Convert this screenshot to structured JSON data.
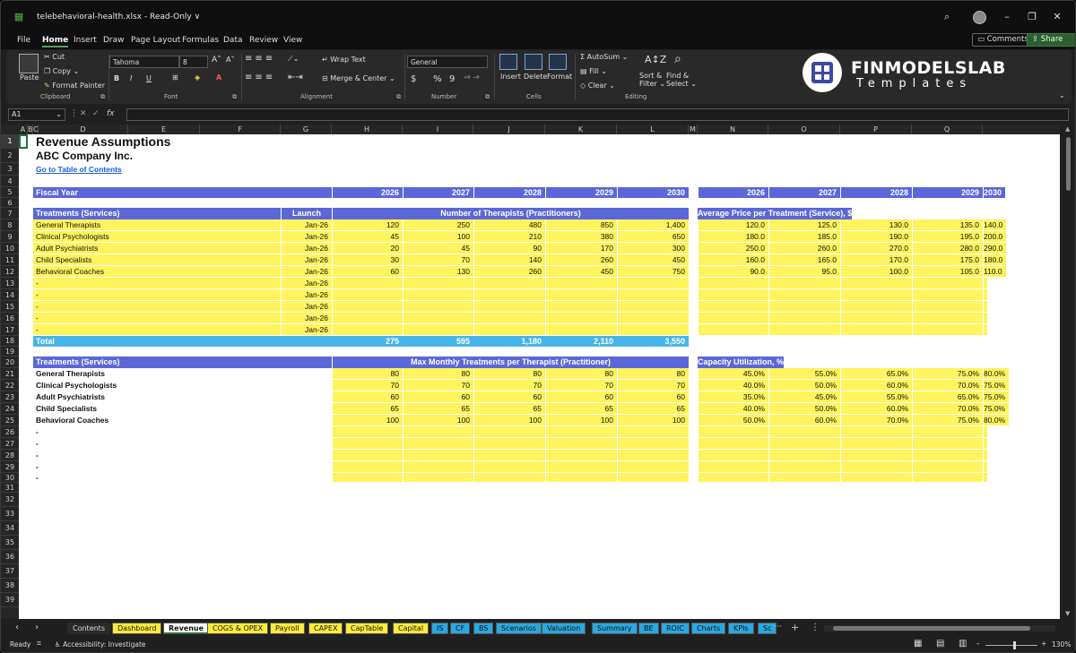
{
  "window": {
    "title": "telebehavioral-health.xlsx  -  Read-Only",
    "chevron": "∨"
  },
  "menu": [
    "File",
    "Home",
    "Insert",
    "Draw",
    "Page Layout",
    "Formulas",
    "Data",
    "Review",
    "View"
  ],
  "menu_right": {
    "comments": "Comments",
    "share": "Share"
  },
  "ribbon": {
    "clipboard": {
      "paste": "Paste",
      "cut": "Cut",
      "copy": "Copy",
      "format_painter": "Format Painter",
      "label": "Clipboard"
    },
    "font": {
      "name": "Tahoma",
      "size": "8",
      "bold": "B",
      "italic": "I",
      "underline": "U",
      "label": "Font"
    },
    "alignment": {
      "wrap": "Wrap Text",
      "merge": "Merge & Center",
      "label": "Alignment"
    },
    "number": {
      "format": "General",
      "currency": "$",
      "percent": "%",
      "comma": "9",
      "label": "Number"
    },
    "cells": {
      "insert": "Insert",
      "delete": "Delete",
      "format": "Format",
      "label": "Cells"
    },
    "editing": {
      "autosum": "AutoSum",
      "fill": "Fill",
      "clear": "Clear",
      "sort1": "Sort &",
      "sort2": "Filter",
      "find1": "Find &",
      "find2": "Select",
      "label": "Editing"
    },
    "logo": {
      "line1": "FINMODELSLAB",
      "line2": "Templates"
    }
  },
  "formula_bar": {
    "name_box": "A1",
    "fx": "fx"
  },
  "columns": [
    "A",
    "B",
    "C",
    "D",
    "E",
    "F",
    "G",
    "H",
    "I",
    "J",
    "K",
    "L",
    "M",
    "N",
    "O",
    "P",
    "Q"
  ],
  "rows": [
    "1",
    "2",
    "3",
    "4",
    "5",
    "6",
    "7",
    "8",
    "9",
    "10",
    "11",
    "12",
    "13",
    "14",
    "15",
    "16",
    "17",
    "18",
    "19",
    "20",
    "21",
    "22",
    "23",
    "24",
    "25",
    "26",
    "27",
    "28",
    "29",
    "30",
    "31",
    "32",
    "33",
    "34",
    "35",
    "36",
    "37",
    "38",
    "39"
  ],
  "sheet": {
    "title": "Revenue Assumptions",
    "company": "ABC Company Inc.",
    "toc_link": "Go to Table of Contents",
    "fiscal_year_label": "Fiscal Year",
    "years": [
      "2026",
      "2027",
      "2028",
      "2029",
      "2030"
    ],
    "t1_header": "Treatments (Services)",
    "launch_header": "Launch",
    "therapists_header": "Number of Therapists (Practitioners)",
    "price_header": "Average Price per Treatment (Service), $",
    "t1_rows": [
      {
        "name": "General Therapists",
        "launch": "Jan-26",
        "therapists": [
          "120",
          "250",
          "480",
          "850",
          "1,400"
        ],
        "price": [
          "120.0",
          "125.0",
          "130.0",
          "135.0",
          "140.0"
        ]
      },
      {
        "name": "Clinical Psychologists",
        "launch": "Jan-26",
        "therapists": [
          "45",
          "100",
          "210",
          "380",
          "650"
        ],
        "price": [
          "180.0",
          "185.0",
          "190.0",
          "195.0",
          "200.0"
        ]
      },
      {
        "name": "Adult Psychiatrists",
        "launch": "Jan-26",
        "therapists": [
          "20",
          "45",
          "90",
          "170",
          "300"
        ],
        "price": [
          "250.0",
          "260.0",
          "270.0",
          "280.0",
          "290.0"
        ]
      },
      {
        "name": "Child Specialists",
        "launch": "Jan-26",
        "therapists": [
          "30",
          "70",
          "140",
          "260",
          "450"
        ],
        "price": [
          "160.0",
          "165.0",
          "170.0",
          "175.0",
          "180.0"
        ]
      },
      {
        "name": "Behavioral Coaches",
        "launch": "Jan-26",
        "therapists": [
          "60",
          "130",
          "260",
          "450",
          "750"
        ],
        "price": [
          "90.0",
          "95.0",
          "100.0",
          "105.0",
          "110.0"
        ]
      },
      {
        "name": "-",
        "launch": "Jan-26",
        "therapists": [
          "",
          "",
          "",
          "",
          ""
        ],
        "price": [
          "",
          "",
          "",
          "",
          ""
        ]
      },
      {
        "name": "-",
        "launch": "Jan-26",
        "therapists": [
          "",
          "",
          "",
          "",
          ""
        ],
        "price": [
          "",
          "",
          "",
          "",
          ""
        ]
      },
      {
        "name": "-",
        "launch": "Jan-26",
        "therapists": [
          "",
          "",
          "",
          "",
          ""
        ],
        "price": [
          "",
          "",
          "",
          "",
          ""
        ]
      },
      {
        "name": "-",
        "launch": "Jan-26",
        "therapists": [
          "",
          "",
          "",
          "",
          ""
        ],
        "price": [
          "",
          "",
          "",
          "",
          ""
        ]
      },
      {
        "name": "-",
        "launch": "Jan-26",
        "therapists": [
          "",
          "",
          "",
          "",
          ""
        ],
        "price": [
          "",
          "",
          "",
          "",
          ""
        ]
      }
    ],
    "total_label": "Total",
    "totals": [
      "275",
      "595",
      "1,180",
      "2,110",
      "3,550"
    ],
    "t2_header": "Treatments (Services)",
    "max_header": "Max Monthly Treatments per Therapist (Practitioner)",
    "cap_header": "Capacity Utilization, %",
    "t2_rows": [
      {
        "name": "General Therapists",
        "max": [
          "80",
          "80",
          "80",
          "80",
          "80"
        ],
        "cap": [
          "45.0%",
          "55.0%",
          "65.0%",
          "75.0%",
          "80.0%"
        ]
      },
      {
        "name": "Clinical Psychologists",
        "max": [
          "70",
          "70",
          "70",
          "70",
          "70"
        ],
        "cap": [
          "40.0%",
          "50.0%",
          "60.0%",
          "70.0%",
          "75.0%"
        ]
      },
      {
        "name": "Adult Psychiatrists",
        "max": [
          "60",
          "60",
          "60",
          "60",
          "60"
        ],
        "cap": [
          "35.0%",
          "45.0%",
          "55.0%",
          "65.0%",
          "75.0%"
        ]
      },
      {
        "name": "Child Specialists",
        "max": [
          "65",
          "65",
          "65",
          "65",
          "65"
        ],
        "cap": [
          "40.0%",
          "50.0%",
          "60.0%",
          "70.0%",
          "75.0%"
        ]
      },
      {
        "name": "Behavioral Coaches",
        "max": [
          "100",
          "100",
          "100",
          "100",
          "100"
        ],
        "cap": [
          "50.0%",
          "60.0%",
          "70.0%",
          "75.0%",
          "80.0%"
        ]
      },
      {
        "name": "-",
        "max": [
          "",
          "",
          "",
          "",
          ""
        ],
        "cap": [
          "",
          "",
          "",
          "",
          ""
        ]
      },
      {
        "name": "-",
        "max": [
          "",
          "",
          "",
          "",
          ""
        ],
        "cap": [
          "",
          "",
          "",
          "",
          ""
        ]
      },
      {
        "name": "-",
        "max": [
          "",
          "",
          "",
          "",
          ""
        ],
        "cap": [
          "",
          "",
          "",
          "",
          ""
        ]
      },
      {
        "name": "-",
        "max": [
          "",
          "",
          "",
          "",
          ""
        ],
        "cap": [
          "",
          "",
          "",
          "",
          ""
        ]
      },
      {
        "name": "-",
        "max": [
          "",
          "",
          "",
          "",
          ""
        ],
        "cap": [
          "",
          "",
          "",
          "",
          ""
        ]
      }
    ]
  },
  "tabs": [
    {
      "label": "Contents",
      "style": "w"
    },
    {
      "label": "Dashboard",
      "style": "y"
    },
    {
      "label": "Revenue",
      "style": "active"
    },
    {
      "label": "COGS & OPEX",
      "style": "y"
    },
    {
      "label": "Payroll",
      "style": "y"
    },
    {
      "label": "CAPEX",
      "style": "y"
    },
    {
      "label": "CapTable",
      "style": "y"
    },
    {
      "label": "Capital",
      "style": "y"
    },
    {
      "label": "IS",
      "style": "b"
    },
    {
      "label": "CF",
      "style": "b"
    },
    {
      "label": "BS",
      "style": "b"
    },
    {
      "label": "Scenarios",
      "style": "b"
    },
    {
      "label": "Valuation",
      "style": "b"
    },
    {
      "label": "Summary",
      "style": "b"
    },
    {
      "label": "BE",
      "style": "b"
    },
    {
      "label": "ROIC",
      "style": "b"
    },
    {
      "label": "Charts",
      "style": "b"
    },
    {
      "label": "KPIs",
      "style": "b"
    },
    {
      "label": "Sc",
      "style": "b"
    }
  ],
  "status": {
    "ready": "Ready",
    "accessibility": "Accessibility: Investigate",
    "zoom": "130%"
  }
}
